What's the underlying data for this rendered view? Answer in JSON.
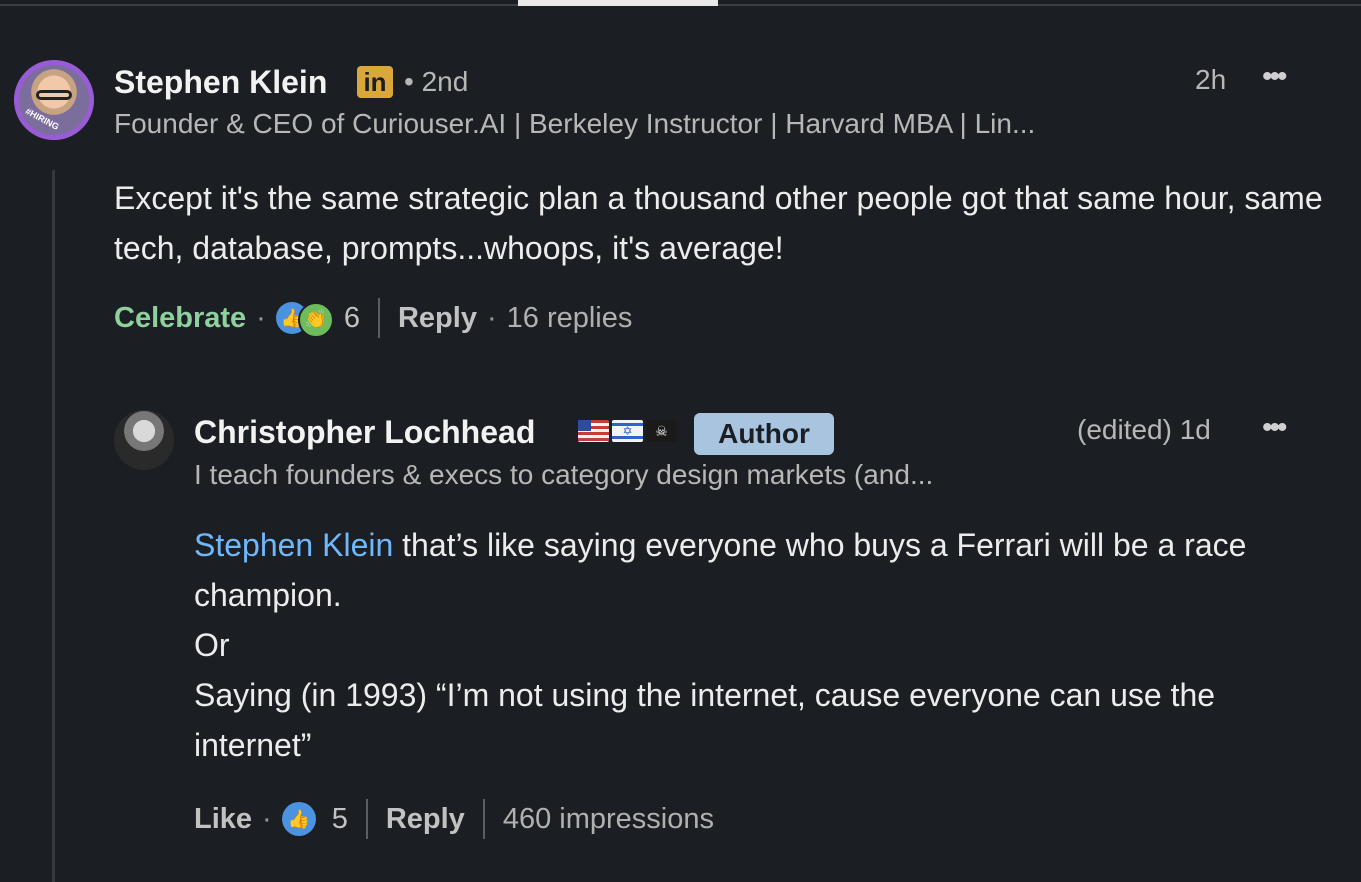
{
  "comment1": {
    "name": "Stephen Klein",
    "badge": "in",
    "avatar_label": "#HIRING",
    "degree": "• 2nd",
    "time": "2h",
    "more": "•••",
    "headline": "Founder & CEO of Curiouser.AI | Berkeley Instructor | Harvard MBA | Lin...",
    "text": "Except it's the same strategic plan a thousand other people got that same hour, same tech, database, prompts...whoops, it's average!",
    "reaction_label": "Celebrate",
    "reaction_count": "6",
    "reply_label": "Reply",
    "replies": "16 replies",
    "dot": "·",
    "icons": [
      "like-icon",
      "celebrate-icon"
    ]
  },
  "comment2": {
    "name": "Christopher Lochhead",
    "flags": [
      "us-flag-icon",
      "israel-flag-icon",
      "pirate-flag-icon"
    ],
    "author_badge": "Author",
    "time": "(edited) 1d",
    "more": "•••",
    "headline": "I teach founders & execs to category design markets (and...",
    "mention": "Stephen Klein",
    "text_line1": " that’s like saying everyone who buys a Ferrari will be a race champion.",
    "text_line2": "Or",
    "text_line3": "Saying (in 1993) “I’m not using the internet, cause everyone can use the internet”",
    "like_label": "Like",
    "dot": "·",
    "like_count": "5",
    "reply_label": "Reply",
    "impressions": "460 impressions"
  },
  "colors": {
    "background": "#1b1f23",
    "celebrate_green": "#8fd19e",
    "mention_blue": "#71b7fb",
    "author_badge_bg": "#a8c4df",
    "linkedin_badge": "#d9a73a"
  }
}
